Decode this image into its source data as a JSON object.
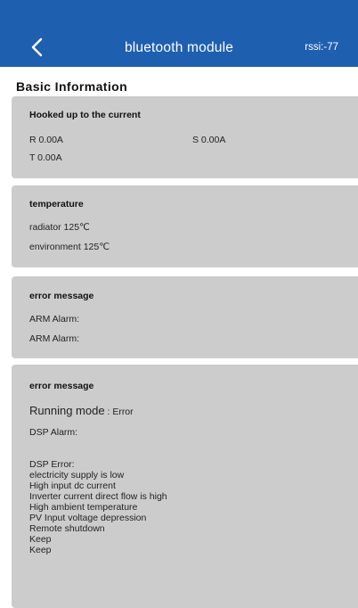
{
  "header": {
    "title": "bluetooth module",
    "rssi": "rssi:-77",
    "back_icon": "chevron-left-icon"
  },
  "section_title": "Basic Information",
  "current_card": {
    "title": "Hooked up to the current",
    "r": "R 0.00A",
    "s": "S 0.00A",
    "t": "T 0.00A"
  },
  "temperature_card": {
    "title": "temperature",
    "radiator": "radiator  125℃",
    "environment": "environment 125℃"
  },
  "error_card_1": {
    "title": "error message",
    "line1": "ARM Alarm:",
    "line2": "ARM Alarm:"
  },
  "error_card_2": {
    "title": "error message",
    "running_mode_label": "Running mode",
    "running_mode_value": " : Error",
    "dsp_alarm": "DSP Alarm:",
    "errors": [
      "DSP Error:",
      "electricity supply is low",
      "High input dc current",
      "Inverter current direct flow is high",
      "High ambient temperature",
      "PV Input voltage depression",
      "Remote shutdown",
      "Keep",
      "Keep"
    ]
  },
  "colors": {
    "header_bg": "#1f5fb0",
    "card_bg": "#cccccc"
  }
}
